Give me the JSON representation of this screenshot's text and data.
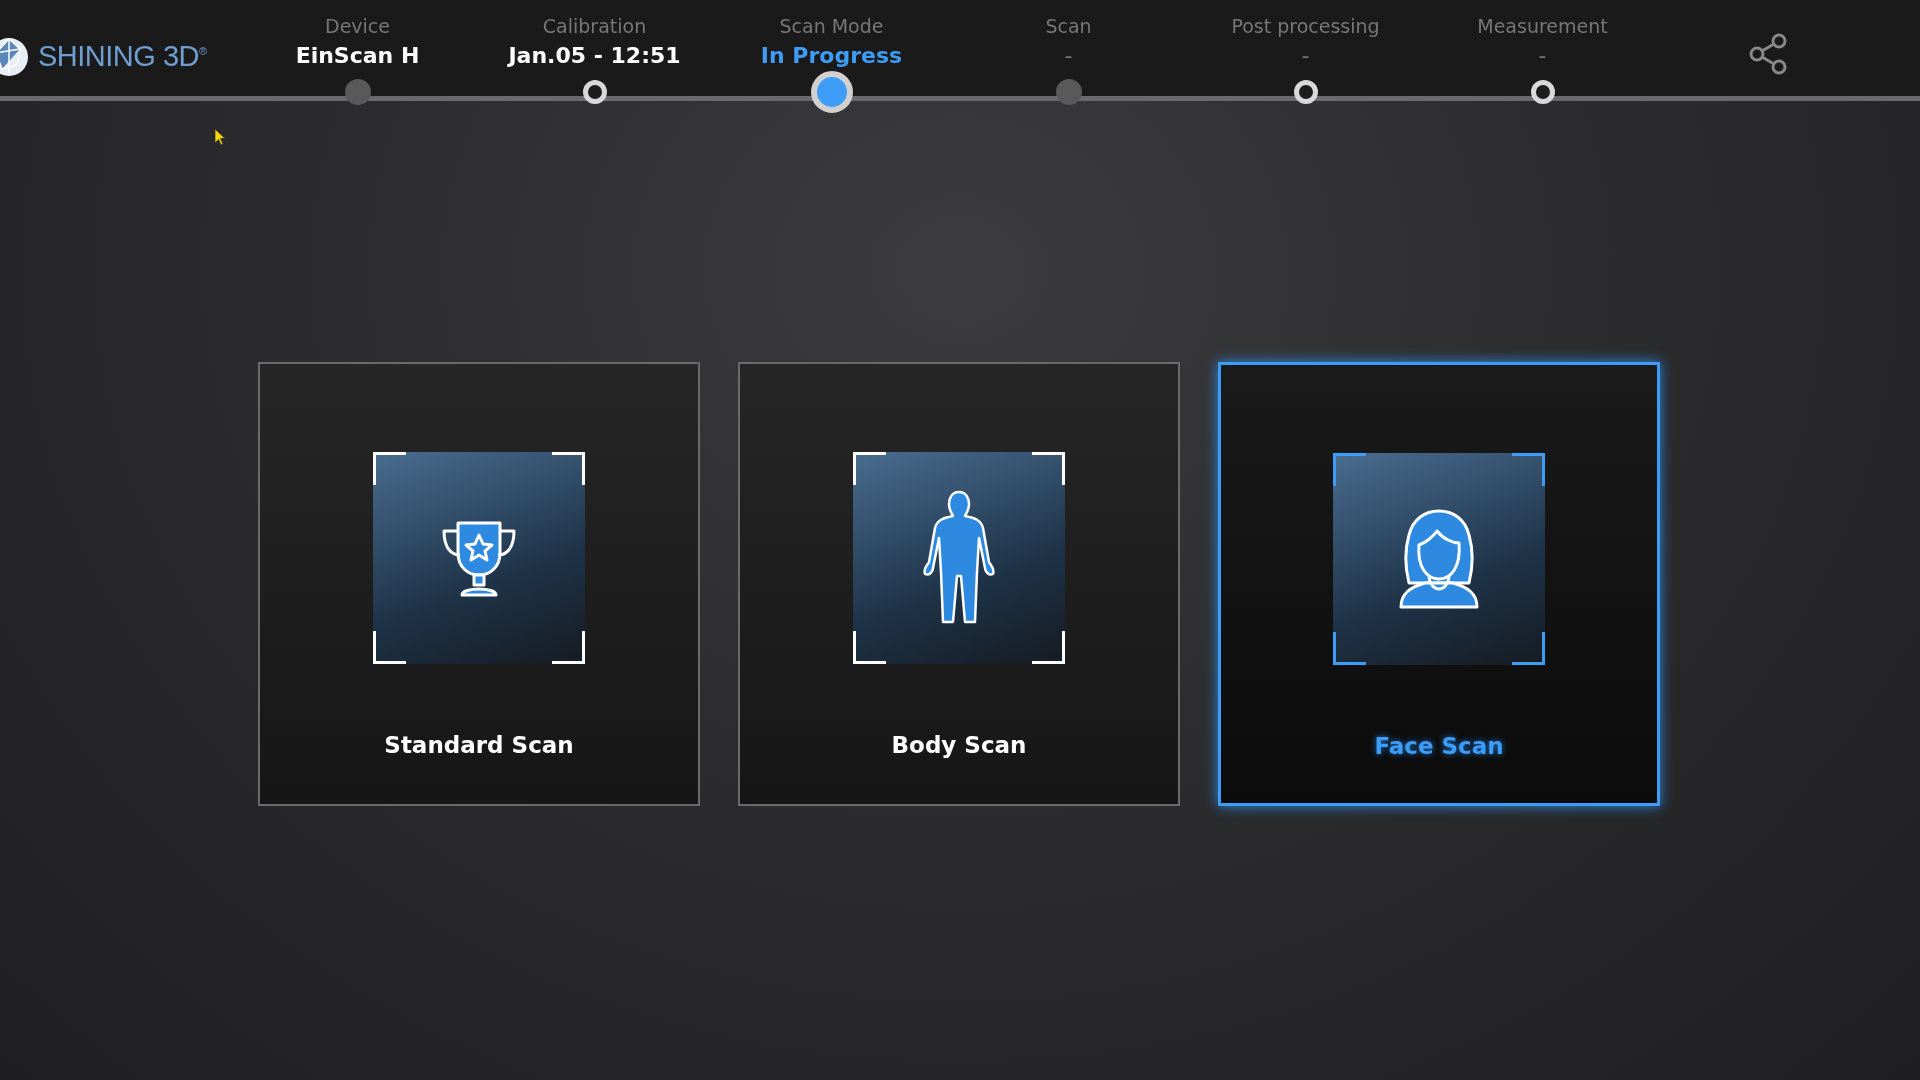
{
  "logo": {
    "text": "SHINING 3D$^{®}$"
  },
  "steps": [
    {
      "label": "Device",
      "value": "EinScan H",
      "current": false,
      "completed": true,
      "enabled": false
    },
    {
      "label": "Calibration",
      "value": "Jan.05 - 12:51",
      "current": false,
      "completed": true,
      "enabled": true
    },
    {
      "label": "Scan Mode",
      "value": "In Progress",
      "current": true,
      "completed": false,
      "enabled": true
    },
    {
      "label": "Scan",
      "value": "-",
      "current": false,
      "completed": false,
      "enabled": false
    },
    {
      "label": "Post processing",
      "value": "-",
      "current": false,
      "completed": false,
      "enabled": true
    },
    {
      "label": "Measurement",
      "value": "-",
      "current": false,
      "completed": false,
      "enabled": true
    }
  ],
  "scan_modes": [
    {
      "label": "Standard Scan",
      "kind": "trophy",
      "selected": false
    },
    {
      "label": "Body Scan",
      "kind": "body",
      "selected": false
    },
    {
      "label": "Face Scan",
      "kind": "face",
      "selected": true
    }
  ]
}
